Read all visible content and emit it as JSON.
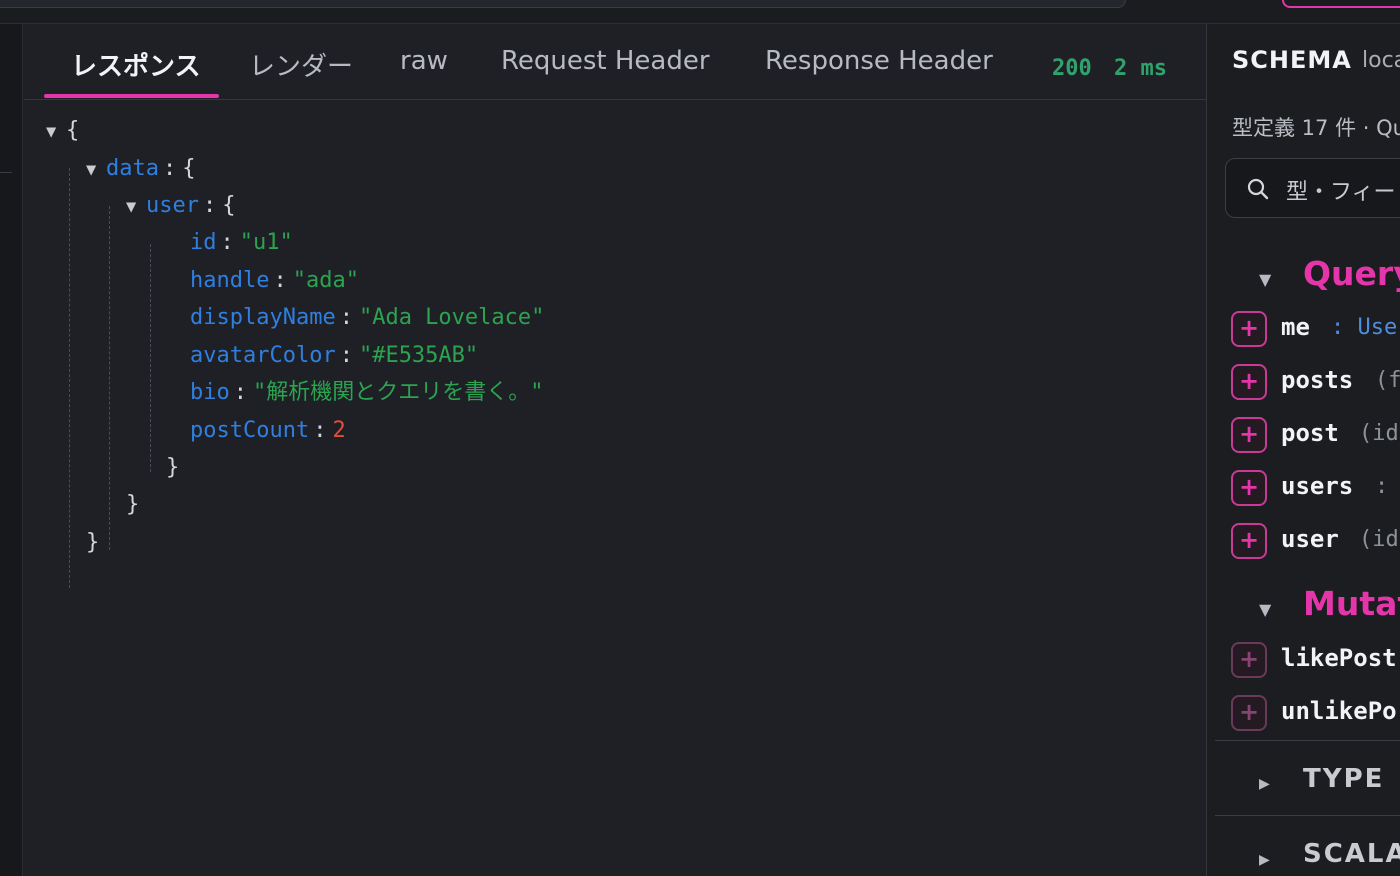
{
  "tabs": [
    {
      "label": "レスポンス"
    },
    {
      "label": "レンダー"
    },
    {
      "label": "raw"
    },
    {
      "label": "Request Header"
    },
    {
      "label": "Response Header"
    }
  ],
  "status": {
    "code": "200",
    "time": "2 ms"
  },
  "json": {
    "open_root": "{",
    "data_key": "data",
    "user_key": "user",
    "fields": [
      {
        "key": "id",
        "value": "\"u1\"",
        "kind": "string"
      },
      {
        "key": "handle",
        "value": "\"ada\"",
        "kind": "string"
      },
      {
        "key": "displayName",
        "value": "\"Ada Lovelace\"",
        "kind": "string"
      },
      {
        "key": "avatarColor",
        "value": "\"#E535AB\"",
        "kind": "string"
      },
      {
        "key": "bio",
        "value": "\"解析機関とクエリを書く。\"",
        "kind": "string"
      },
      {
        "key": "postCount",
        "value": "2",
        "kind": "number"
      }
    ],
    "colon": ":",
    "open": "{",
    "close": "}"
  },
  "schema": {
    "title": "SCHEMA",
    "subtitle": "loca",
    "count": "型定義 17 件 · Qu",
    "search_placeholder": "型・フィー",
    "query": {
      "title": "Query",
      "fields": [
        {
          "name": "me",
          "suffix": ": Use",
          "suffix_type": true
        },
        {
          "name": "posts",
          "suffix": "(f",
          "suffix_type": false
        },
        {
          "name": "post",
          "suffix": "(id",
          "suffix_type": false
        },
        {
          "name": "users",
          "suffix": ":",
          "suffix_type": false
        },
        {
          "name": "user",
          "suffix": "(id",
          "suffix_type": false
        }
      ]
    },
    "mutation": {
      "title": "Mutat",
      "fields": [
        {
          "name": "likePost"
        },
        {
          "name": "unlikePo"
        }
      ]
    },
    "type_section": "TYPE",
    "scalar_section": "SCALA",
    "plus": "+",
    "expanded_icon": "▼",
    "collapsed_icon": "▶"
  },
  "colors": {
    "accent": "#E535AB",
    "key": "#2F7FE0",
    "string": "#2BA34F",
    "number": "#E24E3C",
    "status": "#2FA36B"
  }
}
